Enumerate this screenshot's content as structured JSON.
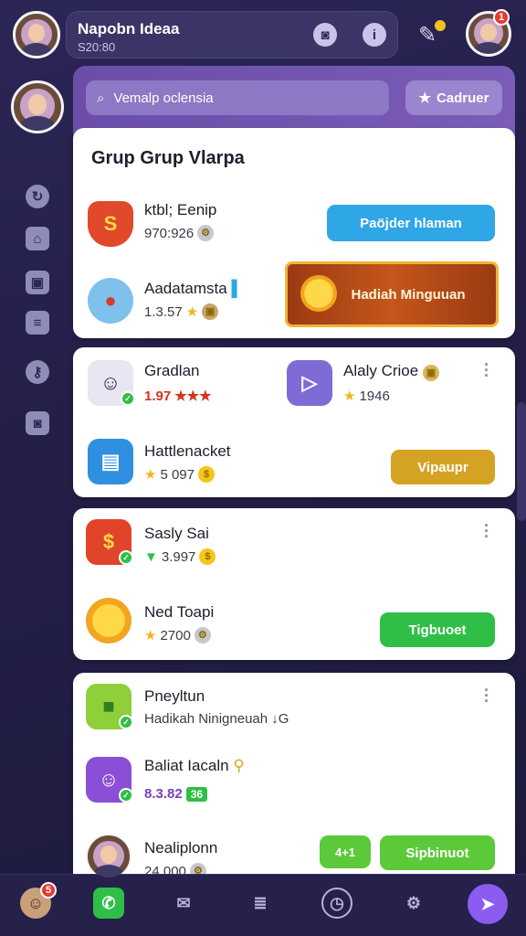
{
  "header": {
    "user_name": "Napobn Ideaa",
    "user_sub": "S20:80",
    "notif_badge": "1"
  },
  "search": {
    "placeholder": "Vemalp oclensia",
    "button_label": "Cadruer"
  },
  "card1": {
    "title": "Grup Grup Vlarpa",
    "rows": [
      {
        "title": "ktbl; Eenip",
        "sub": "970:926",
        "button": "Paöjder hlaman"
      },
      {
        "title": "Aadatamsta",
        "sub": "1.3.57"
      }
    ],
    "banner": "Hadiah Minguuan"
  },
  "card2": {
    "rows": [
      {
        "title": "Gradlan",
        "sub": "1.97"
      },
      {
        "title": "Alaly Crioe",
        "sub": "1946"
      },
      {
        "title": "Hattlenacket",
        "sub": "5 097",
        "button": "Vipaupr"
      }
    ]
  },
  "card3": {
    "rows": [
      {
        "title": "Sasly Sai",
        "sub": "3.997"
      },
      {
        "title": "Ned Toapi",
        "sub": "2700",
        "button": "Tigbuoet"
      }
    ]
  },
  "card4": {
    "rows": [
      {
        "title": "Pneyltun",
        "sub": "Hadikah Ninigneuah ↓G"
      },
      {
        "title": "Baliat Iacaln",
        "sub": "8.3.82",
        "badge": "36"
      },
      {
        "title": "Nealiplonn",
        "sub": "24.000",
        "button_small": "4+1",
        "button": "Sipbinuot"
      }
    ]
  },
  "colors": {
    "accent": "#8a5cf0",
    "blue_button": "#2fa6e6",
    "gold_button": "#d4a323",
    "green_button": "#2fbf47"
  }
}
